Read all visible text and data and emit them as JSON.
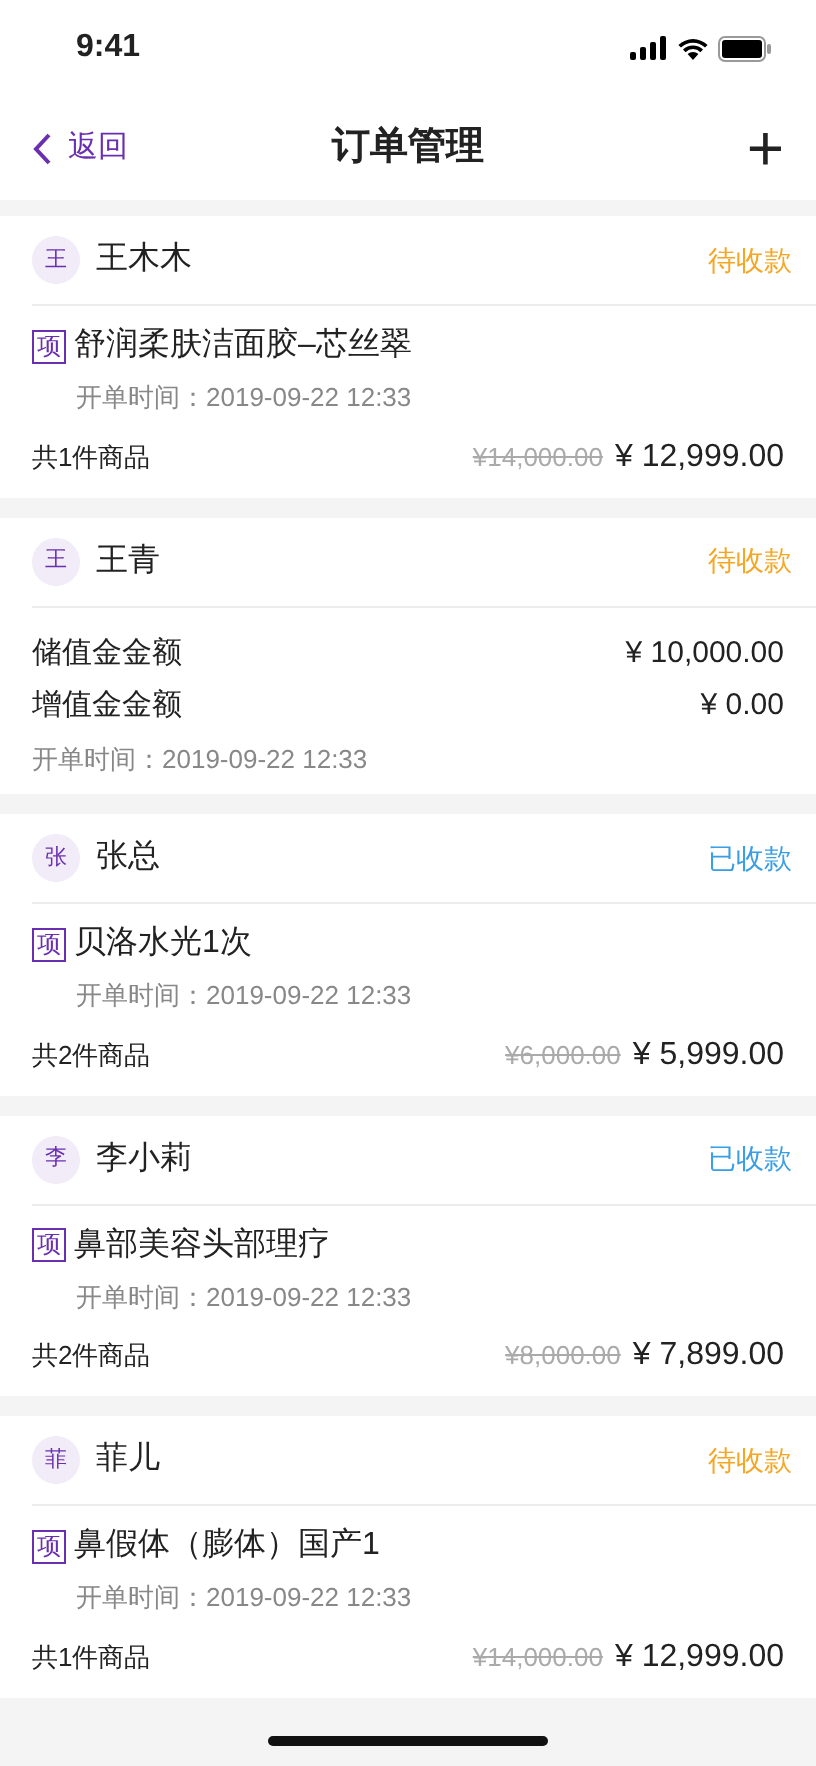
{
  "status_bar": {
    "time": "9:41"
  },
  "nav": {
    "back": "返回",
    "title": "订单管理",
    "add": "+"
  },
  "orders": [
    {
      "kind": "product",
      "avatar": "王",
      "name": "王木木",
      "status": {
        "text": "待收款",
        "color": "#f5a623"
      },
      "tag": "项",
      "item": "舒润柔肤洁面胶–芯丝翠",
      "time": "开单时间：2019-09-22 12:33",
      "count": "共1件商品",
      "original_price": "¥14,000.00",
      "price": "¥ 12,999.00"
    },
    {
      "kind": "stored_value",
      "avatar": "王",
      "name": "王青",
      "status": {
        "text": "待收款",
        "color": "#f5a623"
      },
      "lines": [
        {
          "label": "储值金金额",
          "value": "¥ 10,000.00"
        },
        {
          "label": "增值金金额",
          "value": "¥ 0.00"
        }
      ],
      "time": "开单时间：2019-09-22 12:33"
    },
    {
      "kind": "product",
      "avatar": "张",
      "name": "张总",
      "status": {
        "text": "已收款",
        "color": "#3a9ee4"
      },
      "tag": "项",
      "item": "贝洛水光1次",
      "time": "开单时间：2019-09-22 12:33",
      "count": "共2件商品",
      "original_price": "¥6,000.00",
      "price": "¥ 5,999.00"
    },
    {
      "kind": "product",
      "avatar": "李",
      "name": "李小莉",
      "status": {
        "text": "已收款",
        "color": "#3a9ee4"
      },
      "tag": "项",
      "item": "鼻部美容头部理疗",
      "time": "开单时间：2019-09-22 12:33",
      "count": "共2件商品",
      "original_price": "¥8,000.00",
      "price": "¥ 7,899.00"
    },
    {
      "kind": "product",
      "avatar": "菲",
      "name": "菲儿",
      "status": {
        "text": "待收款",
        "color": "#f5a623"
      },
      "tag": "项",
      "item": "鼻假体（膨体）国产1",
      "time": "开单时间：2019-09-22 12:33",
      "count": "共1件商品",
      "original_price": "¥14,000.00",
      "price": "¥ 12,999.00"
    }
  ]
}
